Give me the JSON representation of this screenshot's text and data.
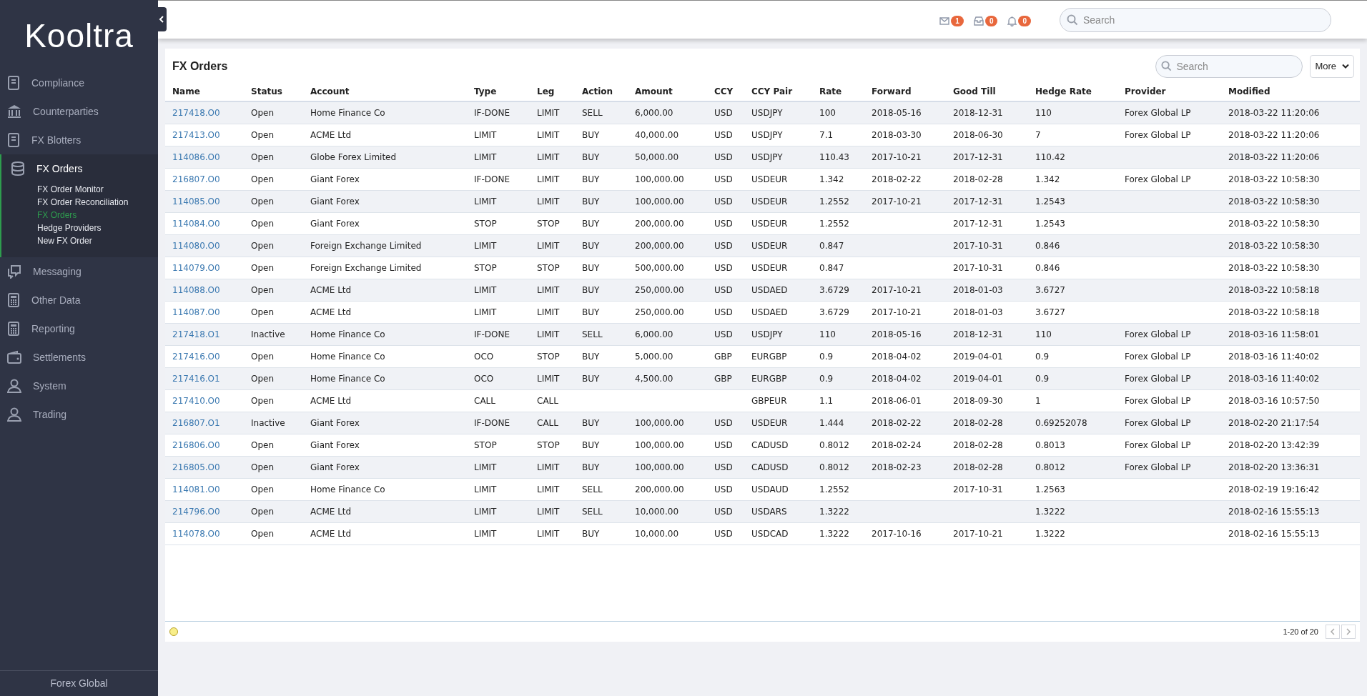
{
  "sidebar": {
    "logo": "Kooltra",
    "items": [
      {
        "label": "Compliance",
        "selected": false
      },
      {
        "label": "Counterparties",
        "selected": false
      },
      {
        "label": "FX Blotters",
        "selected": false
      },
      {
        "label": "FX Orders",
        "selected": true,
        "children": [
          {
            "label": "FX Order Monitor",
            "selected": false
          },
          {
            "label": "FX Order Reconciliation",
            "selected": false
          },
          {
            "label": "FX Orders",
            "selected": true
          },
          {
            "label": "Hedge Providers",
            "selected": false
          },
          {
            "label": "New FX Order",
            "selected": false
          }
        ]
      },
      {
        "label": "Messaging",
        "selected": false
      },
      {
        "label": "Other Data",
        "selected": false
      },
      {
        "label": "Reporting",
        "selected": false
      },
      {
        "label": "Settlements",
        "selected": false
      },
      {
        "label": "System",
        "selected": false
      },
      {
        "label": "Trading",
        "selected": false
      }
    ],
    "footer": "Forex Global"
  },
  "topbar": {
    "badges": [
      {
        "kind": "mail",
        "count": "1"
      },
      {
        "kind": "inbox",
        "count": "0"
      },
      {
        "kind": "bell",
        "count": "0"
      }
    ],
    "search": {
      "placeholder": "Search"
    }
  },
  "panel": {
    "title": "FX Orders",
    "search": {
      "placeholder": "Search"
    },
    "more_button": "More",
    "table": {
      "columns": [
        "Name",
        "Status",
        "Account",
        "Type",
        "Leg",
        "Action",
        "Amount",
        "CCY",
        "CCY Pair",
        "Rate",
        "Forward",
        "Good Till",
        "Hedge Rate",
        "Provider",
        "Modified"
      ],
      "rows": [
        [
          "217418.O0",
          "Open",
          "Home Finance Co",
          "IF-DONE",
          "LIMIT",
          "SELL",
          "6,000.00",
          "USD",
          "USDJPY",
          "100",
          "2018-05-16",
          "2018-12-31",
          "110",
          "Forex Global LP",
          "2018-03-22 11:20:06"
        ],
        [
          "217413.O0",
          "Open",
          "ACME Ltd",
          "LIMIT",
          "LIMIT",
          "BUY",
          "40,000.00",
          "USD",
          "USDJPY",
          "7.1",
          "2018-03-30",
          "2018-06-30",
          "7",
          "Forex Global LP",
          "2018-03-22 11:20:06"
        ],
        [
          "114086.O0",
          "Open",
          "Globe Forex Limited",
          "LIMIT",
          "LIMIT",
          "BUY",
          "50,000.00",
          "USD",
          "USDJPY",
          "110.43",
          "2017-10-21",
          "2017-12-31",
          "110.42",
          "",
          "2018-03-22 11:20:06"
        ],
        [
          "216807.O0",
          "Open",
          "Giant Forex",
          "IF-DONE",
          "LIMIT",
          "BUY",
          "100,000.00",
          "USD",
          "USDEUR",
          "1.342",
          "2018-02-22",
          "2018-02-28",
          "1.342",
          "Forex Global LP",
          "2018-03-22 10:58:30"
        ],
        [
          "114085.O0",
          "Open",
          "Giant Forex",
          "LIMIT",
          "LIMIT",
          "BUY",
          "100,000.00",
          "USD",
          "USDEUR",
          "1.2552",
          "2017-10-21",
          "2017-12-31",
          "1.2543",
          "",
          "2018-03-22 10:58:30"
        ],
        [
          "114084.O0",
          "Open",
          "Giant Forex",
          "STOP",
          "STOP",
          "BUY",
          "200,000.00",
          "USD",
          "USDEUR",
          "1.2552",
          "",
          "2017-12-31",
          "1.2543",
          "",
          "2018-03-22 10:58:30"
        ],
        [
          "114080.O0",
          "Open",
          "Foreign Exchange Limited",
          "LIMIT",
          "LIMIT",
          "BUY",
          "200,000.00",
          "USD",
          "USDEUR",
          "0.847",
          "",
          "2017-10-31",
          "0.846",
          "",
          "2018-03-22 10:58:30"
        ],
        [
          "114079.O0",
          "Open",
          "Foreign Exchange Limited",
          "STOP",
          "STOP",
          "BUY",
          "500,000.00",
          "USD",
          "USDEUR",
          "0.847",
          "",
          "2017-10-31",
          "0.846",
          "",
          "2018-03-22 10:58:30"
        ],
        [
          "114088.O0",
          "Open",
          "ACME Ltd",
          "LIMIT",
          "LIMIT",
          "BUY",
          "250,000.00",
          "USD",
          "USDAED",
          "3.6729",
          "2017-10-21",
          "2018-01-03",
          "3.6727",
          "",
          "2018-03-22 10:58:18"
        ],
        [
          "114087.O0",
          "Open",
          "ACME Ltd",
          "LIMIT",
          "LIMIT",
          "BUY",
          "250,000.00",
          "USD",
          "USDAED",
          "3.6729",
          "2017-10-21",
          "2018-01-03",
          "3.6727",
          "",
          "2018-03-22 10:58:18"
        ],
        [
          "217418.O1",
          "Inactive",
          "Home Finance Co",
          "IF-DONE",
          "LIMIT",
          "SELL",
          "6,000.00",
          "USD",
          "USDJPY",
          "110",
          "2018-05-16",
          "2018-12-31",
          "110",
          "Forex Global LP",
          "2018-03-16 11:58:01"
        ],
        [
          "217416.O0",
          "Open",
          "Home Finance Co",
          "OCO",
          "STOP",
          "BUY",
          "5,000.00",
          "GBP",
          "EURGBP",
          "0.9",
          "2018-04-02",
          "2019-04-01",
          "0.9",
          "Forex Global LP",
          "2018-03-16 11:40:02"
        ],
        [
          "217416.O1",
          "Open",
          "Home Finance Co",
          "OCO",
          "LIMIT",
          "BUY",
          "4,500.00",
          "GBP",
          "EURGBP",
          "0.9",
          "2018-04-02",
          "2019-04-01",
          "0.9",
          "Forex Global LP",
          "2018-03-16 11:40:02"
        ],
        [
          "217410.O0",
          "Open",
          "ACME Ltd",
          "CALL",
          "CALL",
          "",
          "",
          "",
          "GBPEUR",
          "1.1",
          "2018-06-01",
          "2018-09-30",
          "1",
          "Forex Global LP",
          "2018-03-16 10:57:50"
        ],
        [
          "216807.O1",
          "Inactive",
          "Giant Forex",
          "IF-DONE",
          "CALL",
          "BUY",
          "100,000.00",
          "USD",
          "USDEUR",
          "1.444",
          "2018-02-22",
          "2018-02-28",
          "0.69252078",
          "Forex Global LP",
          "2018-02-20 21:17:54"
        ],
        [
          "216806.O0",
          "Open",
          "Giant Forex",
          "STOP",
          "STOP",
          "BUY",
          "100,000.00",
          "USD",
          "CADUSD",
          "0.8012",
          "2018-02-24",
          "2018-02-28",
          "0.8013",
          "Forex Global LP",
          "2018-02-20 13:42:39"
        ],
        [
          "216805.O0",
          "Open",
          "Giant Forex",
          "LIMIT",
          "LIMIT",
          "BUY",
          "100,000.00",
          "USD",
          "CADUSD",
          "0.8012",
          "2018-02-23",
          "2018-02-28",
          "0.8012",
          "Forex Global LP",
          "2018-02-20 13:36:31"
        ],
        [
          "114081.O0",
          "Open",
          "Home Finance Co",
          "LIMIT",
          "LIMIT",
          "SELL",
          "200,000.00",
          "USD",
          "USDAUD",
          "1.2552",
          "",
          "2017-10-31",
          "1.2563",
          "",
          "2018-02-19 19:16:42"
        ],
        [
          "214796.O0",
          "Open",
          "ACME Ltd",
          "LIMIT",
          "LIMIT",
          "SELL",
          "10,000.00",
          "USD",
          "USDARS",
          "1.3222",
          "",
          "",
          "1.3222",
          "",
          "2018-02-16 15:55:13"
        ],
        [
          "114078.O0",
          "Open",
          "ACME Ltd",
          "LIMIT",
          "LIMIT",
          "BUY",
          "10,000.00",
          "USD",
          "USDCAD",
          "1.3222",
          "2017-10-16",
          "2017-10-21",
          "1.3222",
          "",
          "2018-02-16 15:55:13"
        ]
      ]
    },
    "pagination": "1-20 of 20"
  }
}
